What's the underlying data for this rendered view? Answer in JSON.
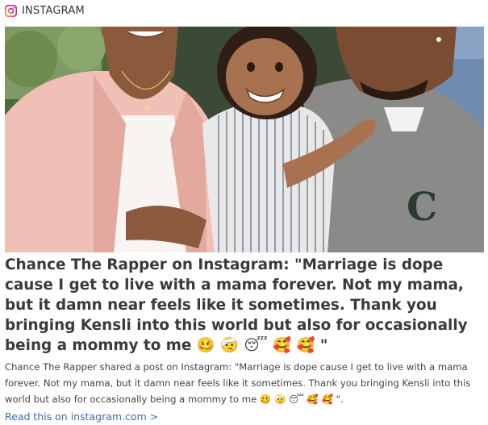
{
  "source": {
    "label": "INSTAGRAM",
    "icon": "instagram-icon"
  },
  "headline": "Chance The Rapper on Instagram: \"Marriage is dope cause I get to live with a mama forever. Not my mama, but it damn near feels like it sometimes. Thank you bringing Kensli into this world but also for occasionally being a mommy to me 🥴 🤕 😴 🥰 🥰 \"",
  "description": "Chance The Rapper shared a post on Instagram: \"Marriage is dope cause I get to live with a mama forever. Not my mama, but it damn near feels like it sometimes. Thank you bringing Kensli into this world but also for occasionally being a mommy to me 🥴 🤕 😴 🥰 🥰 \".",
  "link": {
    "label": "Read this on instagram.com >"
  },
  "colors": {
    "jacket": "#f0bfb5",
    "sweater": "#8a8a88",
    "link": "#3b6fb5",
    "headline": "#3a3a3a"
  }
}
